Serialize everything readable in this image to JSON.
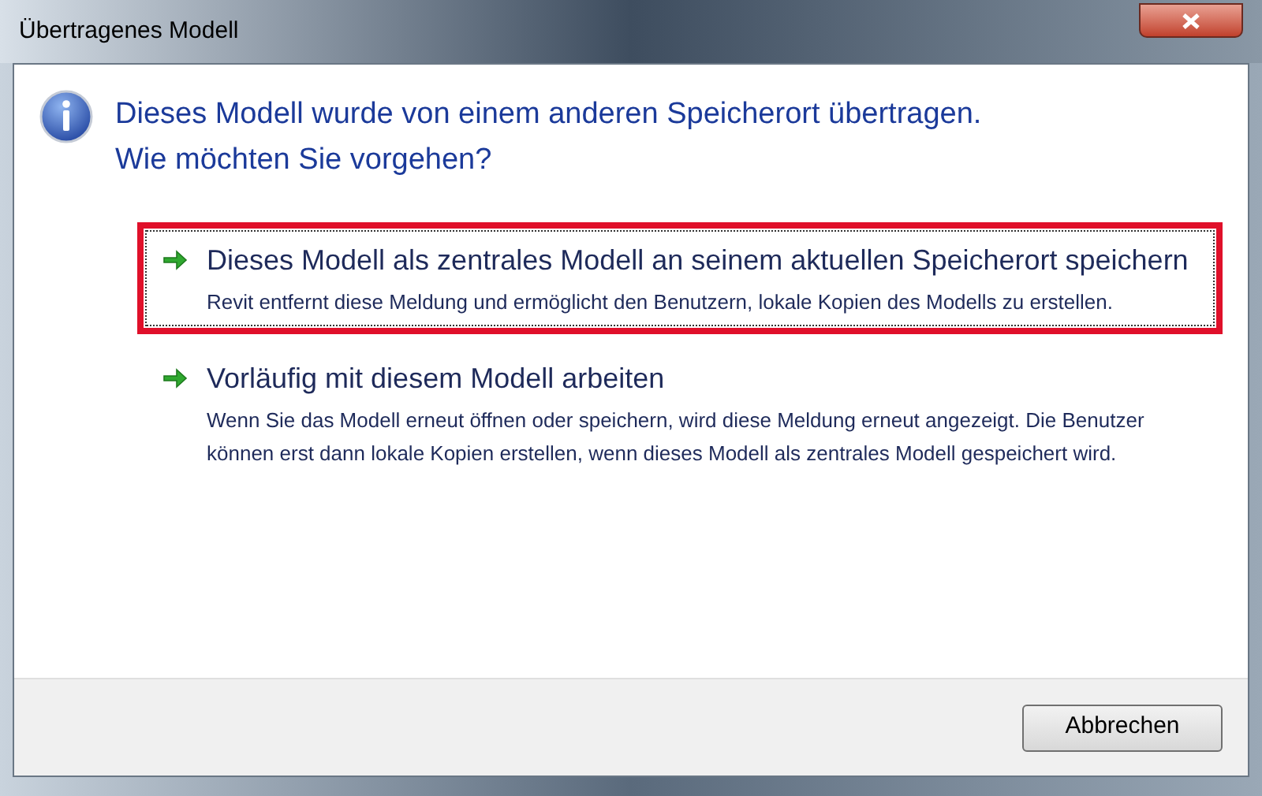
{
  "window": {
    "title": "Übertragenes Modell"
  },
  "instruction": "Dieses Modell wurde von einem anderen Speicherort übertragen. Wie möchten Sie vorgehen?",
  "options": [
    {
      "title": "Dieses Modell als zentrales Modell an seinem aktuellen Speicherort speichern",
      "description": "Revit entfernt diese Meldung und ermöglicht den Benutzern, lokale Kopien des Modells zu erstellen.",
      "selected": true
    },
    {
      "title": "Vorläufig mit diesem Modell arbeiten",
      "description": "Wenn Sie das Modell erneut öffnen oder speichern, wird diese Meldung erneut angezeigt. Die Benutzer können erst dann lokale Kopien erstellen, wenn dieses Modell als zentrales Modell gespeichert wird.",
      "selected": false
    }
  ],
  "buttons": [
    "Abbrechen"
  ]
}
